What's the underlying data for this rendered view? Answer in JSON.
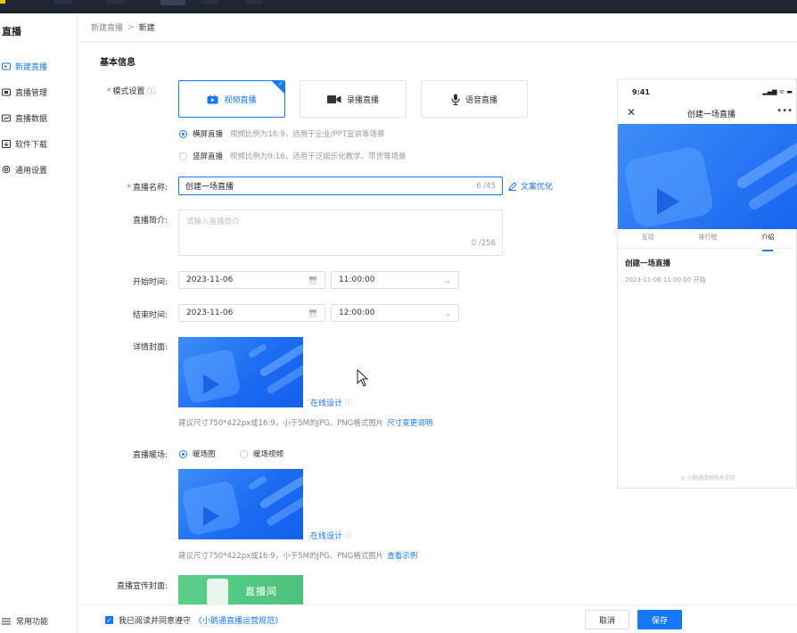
{
  "sidebar": {
    "title": "直播",
    "items": [
      {
        "label": "新建直播",
        "icon": "live-icon",
        "active": true
      },
      {
        "label": "直播管理",
        "icon": "manage-icon"
      },
      {
        "label": "直播数据",
        "icon": "chart-icon"
      },
      {
        "label": "软件下载",
        "icon": "download-icon"
      },
      {
        "label": "通用设置",
        "icon": "gear-icon"
      }
    ],
    "bottom_label": "常用功能"
  },
  "breadcrumb": {
    "parent": "新建直播",
    "separator": ">",
    "current": "新建"
  },
  "section_title": "基本信息",
  "mode": {
    "label": "模式设置",
    "options": [
      {
        "label": "视频直播",
        "selected": true,
        "icon": "video-live-icon"
      },
      {
        "label": "录播直播",
        "icon": "camera-icon"
      },
      {
        "label": "语音直播",
        "icon": "microphone-icon"
      }
    ],
    "orientation": [
      {
        "label": "横屏直播",
        "desc": "视频比例为16:9，适用于企业/PPT宣讲等场景",
        "selected": true
      },
      {
        "label": "竖屏直播",
        "desc": "视频比例为9:16，适用于泛娱乐化教学、带货等场景"
      }
    ]
  },
  "name": {
    "label": "直播名称:",
    "value": "创建一场直播",
    "count": "6 /45",
    "optimize": "文案优化"
  },
  "intro": {
    "label": "直播简介:",
    "placeholder": "请输入直播简介",
    "count": "0 /256"
  },
  "start": {
    "label": "开始时间:",
    "date": "2023-11-06",
    "time": "11:00:00"
  },
  "end": {
    "label": "结束时间:",
    "date": "2023-11-06",
    "time": "12:00:00"
  },
  "detail_cover": {
    "label": "详情封面:",
    "design": "在线设计",
    "hint": "建议尺寸750*422px或16:9，小于5M的JPG、PNG格式图片",
    "hint_link": "尺寸变更说明"
  },
  "warmup": {
    "label": "直播暖场:",
    "options": [
      {
        "label": "暖场图",
        "selected": true
      },
      {
        "label": "暖场视频"
      }
    ],
    "design": "在线设计",
    "hint": "建议尺寸750*422px或16:9，小于5M的JPG、PNG格式图片",
    "hint_link": "查看示例"
  },
  "promo": {
    "label": "直播宣传封面:",
    "banner_text": "直播间"
  },
  "footer": {
    "agree_text": "我已阅读并同意遵守",
    "agree_link": "《小鹅通直播运营规范》",
    "cancel": "取消",
    "save": "保存"
  },
  "preview": {
    "time": "9:41",
    "signal": "▂▄▆ ᯤ ▬",
    "title": "创建一场直播",
    "close": "✕",
    "more": "•••",
    "tabs": [
      {
        "label": "互动"
      },
      {
        "label": "排行榜"
      },
      {
        "label": "介绍",
        "active": true
      }
    ],
    "live_title": "创建一场直播",
    "live_time": "2023-11-06 11:00:00 开始",
    "support": "小鹅通提供技术支持"
  },
  "colors": {
    "accent": "#1677ff",
    "required": "#e34d59",
    "topbar": "#1f2532"
  }
}
